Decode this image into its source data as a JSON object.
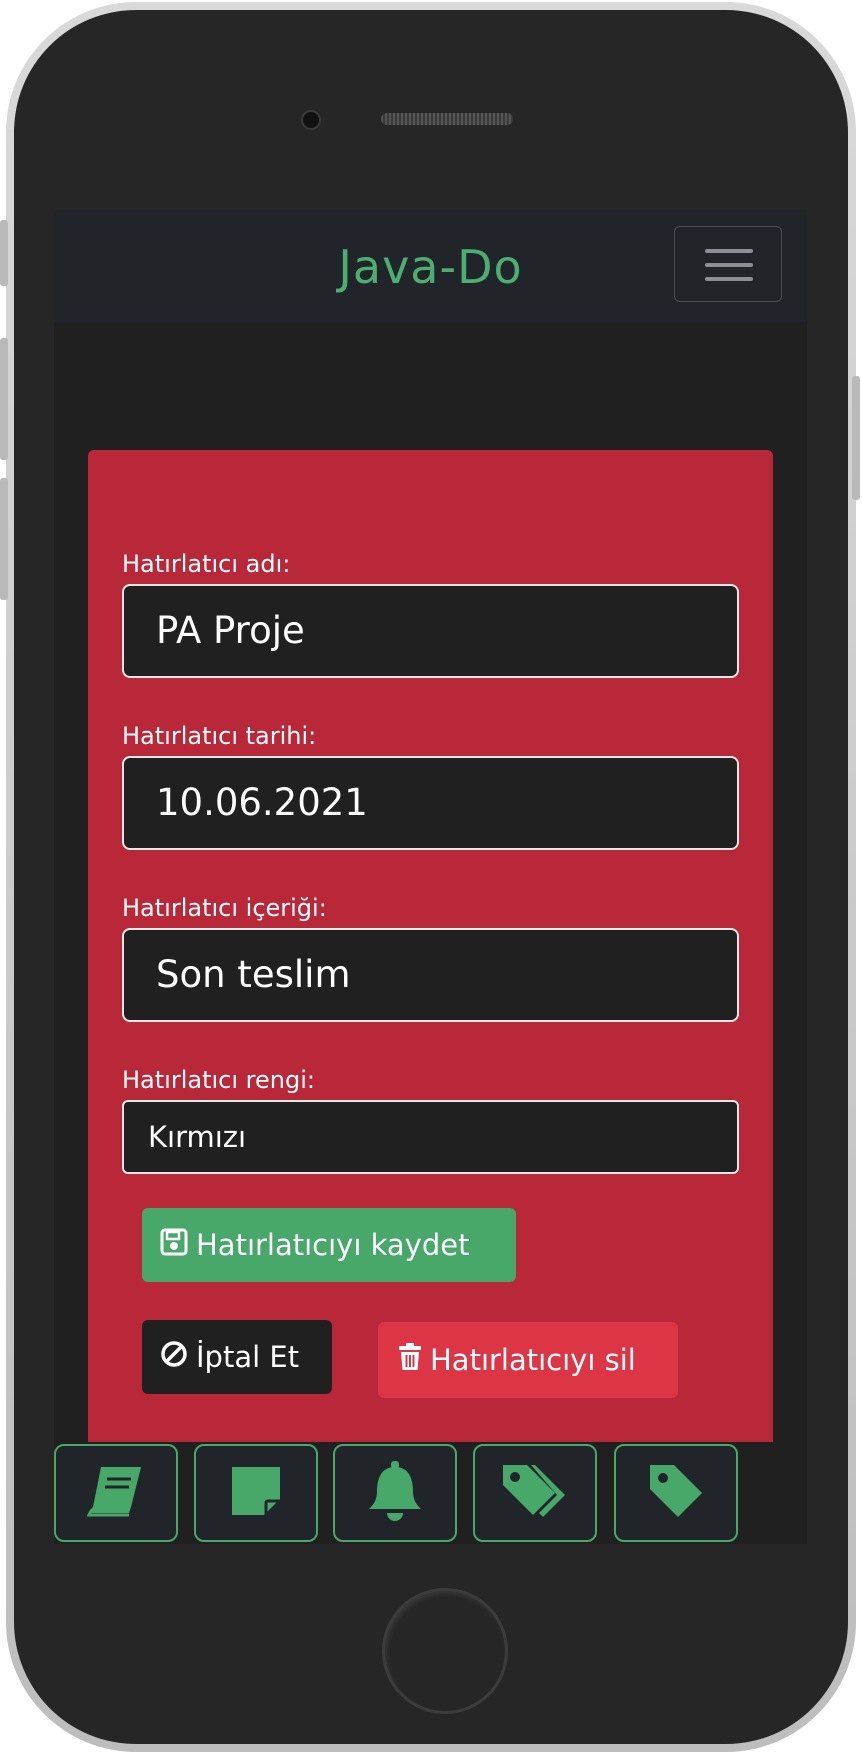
{
  "navbar": {
    "brand": "Java-Do"
  },
  "form": {
    "name_label": "Hatırlatıcı adı:",
    "name_value": "PA Proje",
    "date_label": "Hatırlatıcı tarihi:",
    "date_value": "10.06.2021",
    "content_label": "Hatırlatıcı içeriği:",
    "content_value": "Son teslim",
    "color_label": "Hatırlatıcı rengi:",
    "color_value": "Kırmızı"
  },
  "buttons": {
    "save": "Hatırlatıcıyı kaydet",
    "cancel": "İptal Et",
    "delete": "Hatırlatıcıyı sil"
  },
  "bottom_nav": [
    {
      "icon": "book-icon"
    },
    {
      "icon": "sticky-note-icon"
    },
    {
      "icon": "bell-icon"
    },
    {
      "icon": "tags-icon"
    },
    {
      "icon": "tag-icon"
    }
  ],
  "colors": {
    "accent": "#47a86a",
    "card": "#b92838",
    "danger": "#dc3545",
    "dark": "#202020",
    "navbar": "#212529"
  }
}
